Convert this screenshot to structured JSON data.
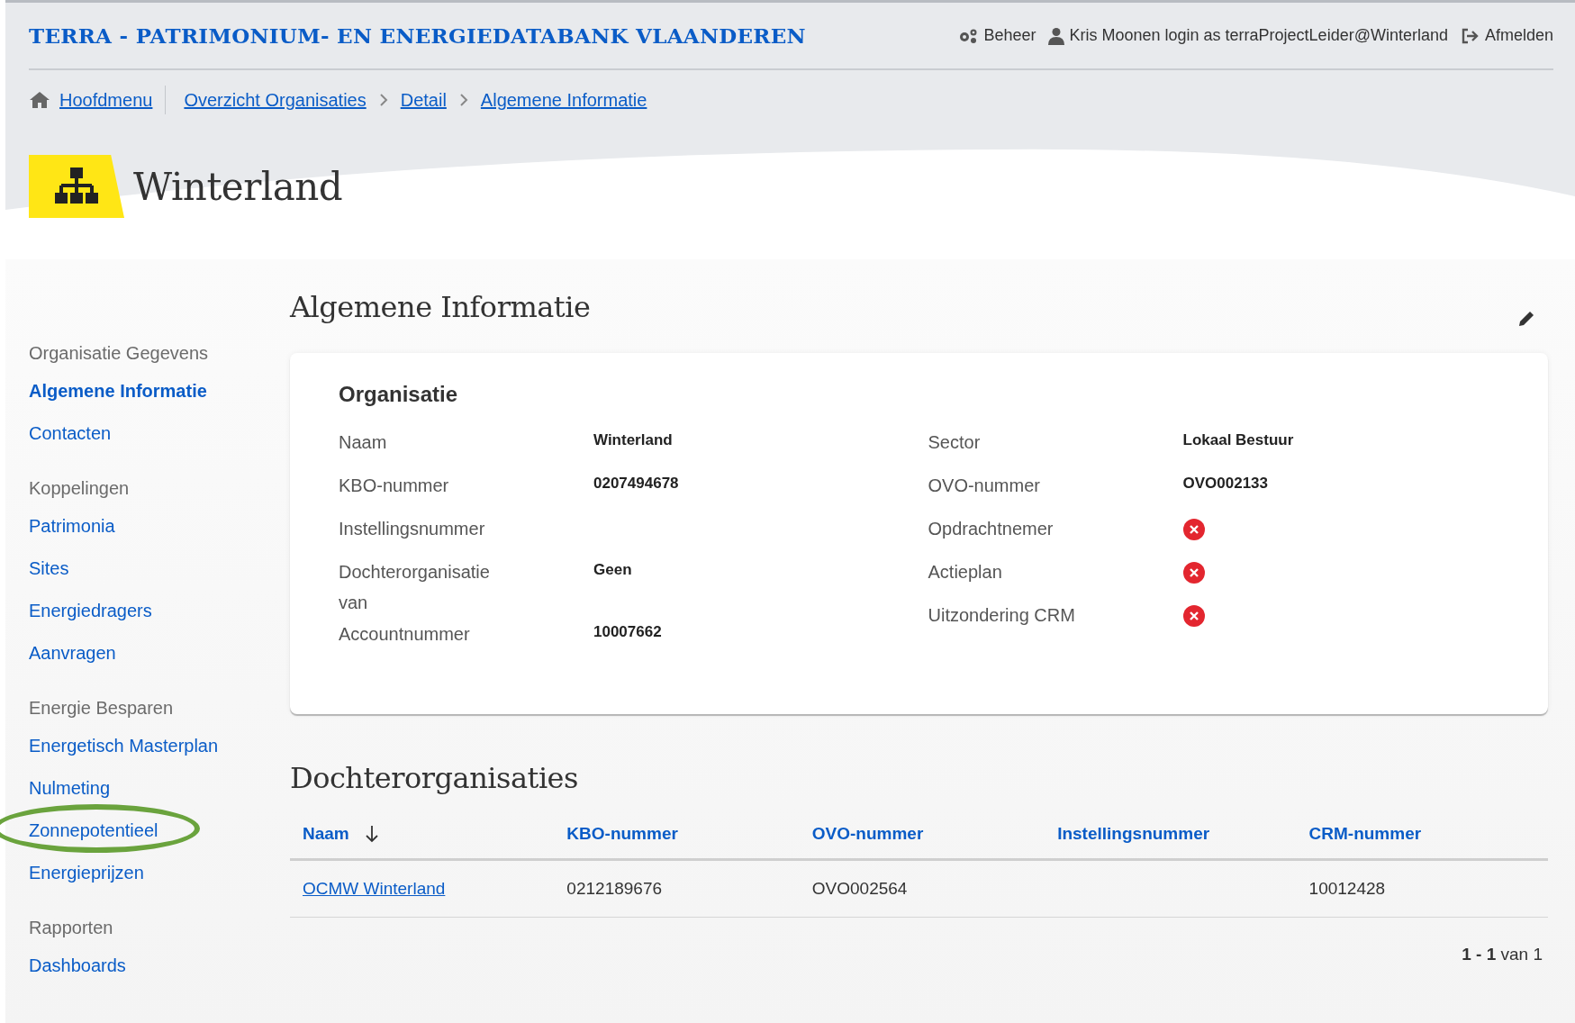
{
  "header": {
    "title": "TERRA - PATRIMONIUM- EN ENERGIEDATABANK VLAANDEREN",
    "actions": [
      {
        "kind": "gear",
        "label": "Beheer"
      },
      {
        "kind": "user",
        "label": "Kris Moonen login as terraProjectLeider@Winterland"
      },
      {
        "kind": "logout",
        "label": "Afmelden"
      }
    ]
  },
  "breadcrumb": [
    "Hoofdmenu",
    "Overzicht Organisaties",
    "Detail",
    "Algemene Informatie"
  ],
  "page_title": "Winterland",
  "sidebar": {
    "items": [
      {
        "kind": "group",
        "label": "Organisatie Gegevens"
      },
      {
        "kind": "link",
        "label": "Algemene Informatie",
        "selected": true,
        "highlighted": false
      },
      {
        "kind": "link",
        "label": "Contacten",
        "selected": false,
        "highlighted": false
      },
      {
        "kind": "group",
        "label": "Koppelingen"
      },
      {
        "kind": "link",
        "label": "Patrimonia",
        "selected": false,
        "highlighted": false
      },
      {
        "kind": "link",
        "label": "Sites",
        "selected": false,
        "highlighted": false
      },
      {
        "kind": "link",
        "label": "Energiedragers",
        "selected": false,
        "highlighted": false
      },
      {
        "kind": "link",
        "label": "Aanvragen",
        "selected": false,
        "highlighted": false
      },
      {
        "kind": "group",
        "label": "Energie Besparen"
      },
      {
        "kind": "link",
        "label": "Energetisch Masterplan",
        "selected": false,
        "highlighted": false
      },
      {
        "kind": "link",
        "label": "Nulmeting",
        "selected": false,
        "highlighted": false
      },
      {
        "kind": "link",
        "label": "Zonnepotentieel",
        "selected": false,
        "highlighted": true
      },
      {
        "kind": "link",
        "label": "Energieprijzen",
        "selected": false,
        "highlighted": false
      },
      {
        "kind": "group",
        "label": "Rapporten"
      },
      {
        "kind": "link",
        "label": "Dashboards",
        "selected": false,
        "highlighted": false
      }
    ]
  },
  "section_title": "Algemene Informatie",
  "card": {
    "title": "Organisatie",
    "columns": [
      [
        {
          "kind": "text",
          "label": "Naam",
          "value": "Winterland"
        },
        {
          "kind": "text",
          "label": "KBO-nummer",
          "value": "0207494678"
        },
        {
          "kind": "empty",
          "label": "Instellingsnummer"
        },
        {
          "kind": "text",
          "label": "Dochterorganisatie van",
          "value": "Geen"
        },
        {
          "kind": "text",
          "label": "Accountnummer",
          "value": "10007662"
        }
      ],
      [
        {
          "kind": "text",
          "label": "Sector",
          "value": "Lokaal Bestuur"
        },
        {
          "kind": "text",
          "label": "OVO-nummer",
          "value": "OVO002133"
        },
        {
          "kind": "flag",
          "label": "Opdrachtnemer",
          "checked": false
        },
        {
          "kind": "flag",
          "label": "Actieplan",
          "checked": false
        },
        {
          "kind": "flag",
          "label": "Uitzondering CRM",
          "checked": false
        }
      ]
    ]
  },
  "table": {
    "title": "Dochterorganisaties",
    "columns": [
      {
        "label": "Naam",
        "sorted": true
      },
      {
        "label": "KBO-nummer",
        "sorted": false
      },
      {
        "label": "OVO-nummer",
        "sorted": false
      },
      {
        "label": "Instellingsnummer",
        "sorted": false
      },
      {
        "label": "CRM-nummer",
        "sorted": false
      }
    ],
    "rows": [
      [
        "OCMW Winterland",
        "0212189676",
        "OVO002564",
        "",
        "10012428"
      ]
    ],
    "pagination": "**1 - 1** van 1"
  }
}
